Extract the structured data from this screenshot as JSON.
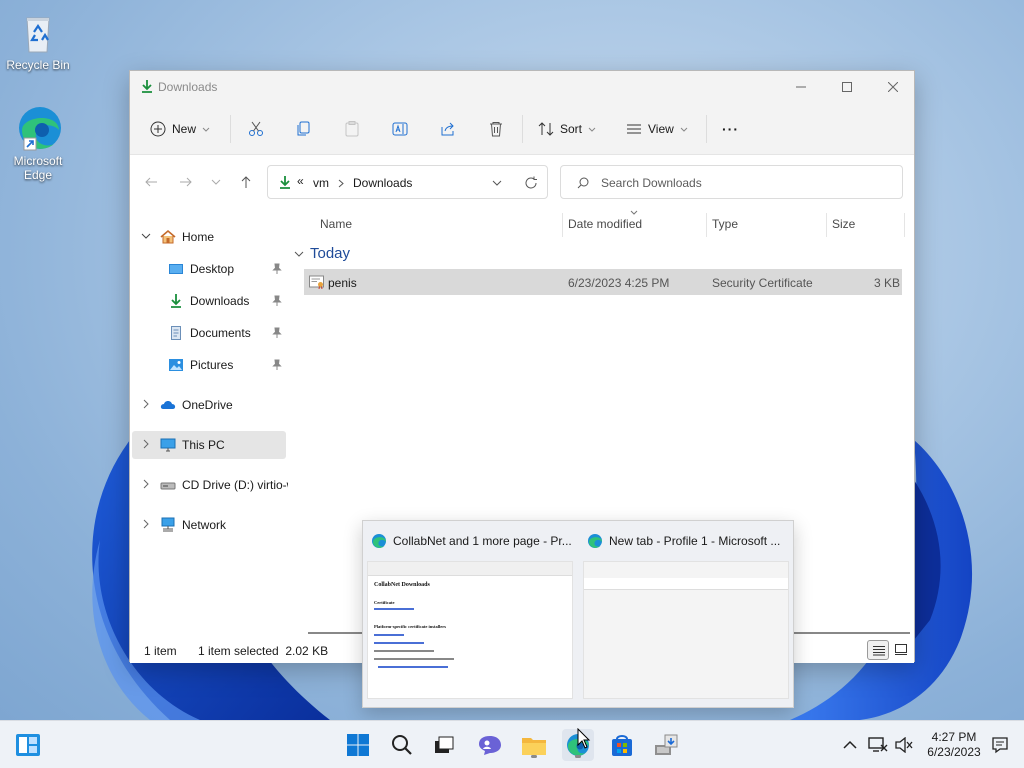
{
  "desktop": {
    "icons": [
      {
        "label": "Recycle Bin"
      },
      {
        "label": "Microsoft Edge"
      }
    ]
  },
  "explorer": {
    "title": "Downloads",
    "commandbar": {
      "new_label": "New",
      "sort_label": "Sort",
      "view_label": "View",
      "more_label": "···"
    },
    "address": {
      "overflow": "«",
      "crumbs": [
        "vm",
        "Downloads"
      ]
    },
    "search": {
      "placeholder": "Search Downloads"
    },
    "nav": {
      "home": "Home",
      "quick": [
        "Desktop",
        "Downloads",
        "Documents",
        "Pictures"
      ],
      "onedrive": "OneDrive",
      "thispc": "This PC",
      "cddrive": "CD Drive (D:) virtio-win",
      "network": "Network"
    },
    "columns": {
      "name": "Name",
      "date": "Date modified",
      "type": "Type",
      "size": "Size"
    },
    "group_label": "Today",
    "files": [
      {
        "name": "penis",
        "date": "6/23/2023 4:25 PM",
        "type": "Security Certificate",
        "size": "3 KB"
      }
    ],
    "status": {
      "count": "1 item",
      "selected": "1 item selected  2.02 KB"
    }
  },
  "flyout": {
    "windows": [
      {
        "title": "CollabNet and 1 more page - Pr...",
        "preview": {
          "heading": "CollabNet Downloads",
          "sections": [
            "Certificate",
            "Platform-specific certificate installers"
          ]
        }
      },
      {
        "title": "New tab - Profile 1 - Microsoft ..."
      }
    ]
  },
  "taskbar": {
    "clock": {
      "time": "4:27 PM",
      "date": "6/23/2023"
    }
  },
  "colors": {
    "accent": "#0067c0",
    "downloads_green": "#1a8f3c",
    "group_blue": "#1f4b99",
    "selection": "#d9d9d9"
  }
}
